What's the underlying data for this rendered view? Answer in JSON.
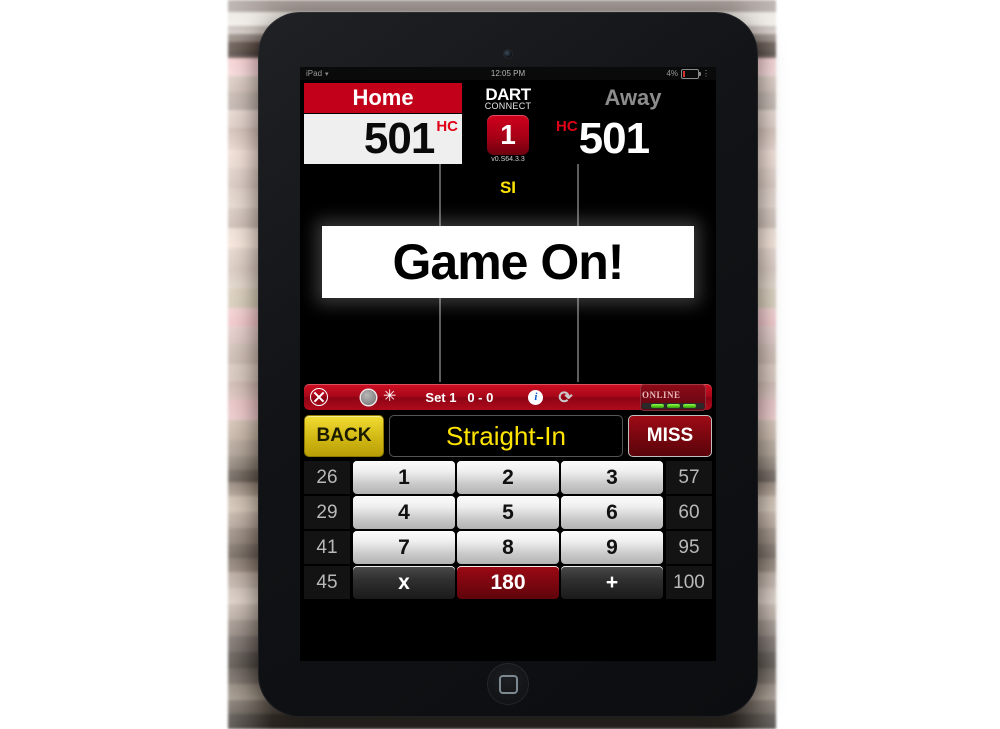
{
  "status_bar": {
    "carrier": "iPad",
    "wifi_icon": "wifi-icon",
    "clock": "12:05 PM",
    "battery_percent": "4%"
  },
  "scoreboard": {
    "home": {
      "name": "Home",
      "score": "501",
      "hc": "HC"
    },
    "away": {
      "name": "Away",
      "score": "501",
      "hc": "HC"
    },
    "logo": {
      "line1": "DART",
      "line2": "CONNECT"
    },
    "leg_number": "1",
    "version": "v0.S64.3.3"
  },
  "game_area": {
    "mode_indicator": "SI",
    "banner": "Game On!"
  },
  "toolbar": {
    "close_icon": "close-circle-icon",
    "record_icon": "record-circle-icon",
    "settings_icon": "gear-icon",
    "set_label": "Set 1",
    "set_score": "0 - 0",
    "info_icon": "info-icon",
    "refresh_icon": "refresh-icon",
    "online_label": "ONLINE",
    "signal_bars": 3
  },
  "action_row": {
    "back": "BACK",
    "mode": "Straight-In",
    "miss": "MISS"
  },
  "keypad": {
    "left_column": [
      "26",
      "29",
      "41",
      "45"
    ],
    "right_column": [
      "57",
      "60",
      "95",
      "100"
    ],
    "numbers": [
      "1",
      "2",
      "3",
      "4",
      "5",
      "6",
      "7",
      "8",
      "9"
    ],
    "bottom_row": [
      {
        "label": "x",
        "style": "dark"
      },
      {
        "label": "180",
        "style": "red"
      },
      {
        "label": "+",
        "style": "dark"
      }
    ]
  },
  "colors": {
    "brand_red": "#c30019",
    "accent_yellow": "#ffe400",
    "toolbar_red": "#a8071a"
  }
}
